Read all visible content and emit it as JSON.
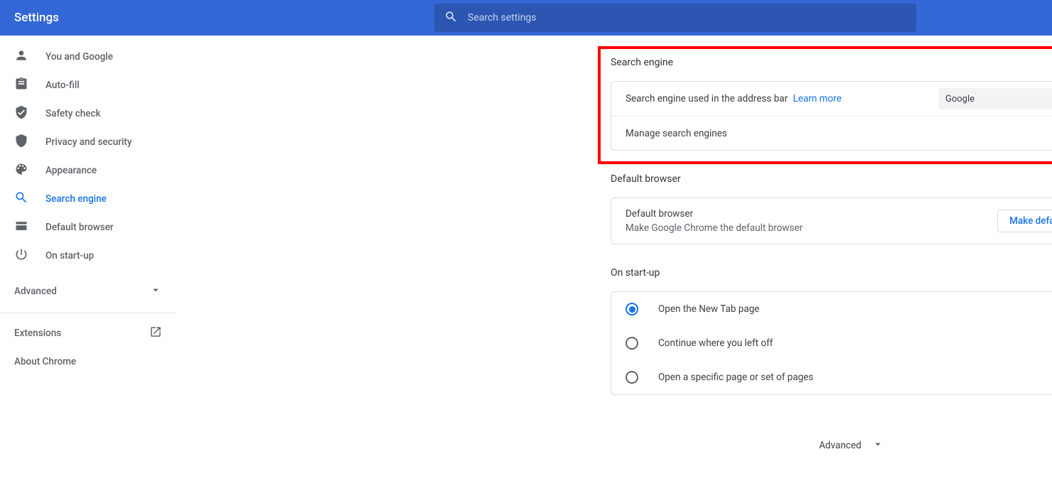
{
  "header": {
    "title": "Settings",
    "search_placeholder": "Search settings"
  },
  "sidebar": {
    "items": [
      {
        "label": "You and Google"
      },
      {
        "label": "Auto-fill"
      },
      {
        "label": "Safety check"
      },
      {
        "label": "Privacy and security"
      },
      {
        "label": "Appearance"
      },
      {
        "label": "Search engine"
      },
      {
        "label": "Default browser"
      },
      {
        "label": "On start-up"
      }
    ],
    "advanced": "Advanced",
    "extensions": "Extensions",
    "about": "About Chrome"
  },
  "sections": {
    "search_engine": {
      "title": "Search engine",
      "row1_text": "Search engine used in the address bar",
      "learn_more": "Learn more",
      "selected": "Google",
      "row2_text": "Manage search engines"
    },
    "default_browser": {
      "title": "Default browser",
      "line1": "Default browser",
      "line2": "Make Google Chrome the default browser",
      "button": "Make default"
    },
    "startup": {
      "title": "On start-up",
      "options": [
        "Open the New Tab page",
        "Continue where you left off",
        "Open a specific page or set of pages"
      ]
    },
    "advanced_footer": "Advanced"
  }
}
